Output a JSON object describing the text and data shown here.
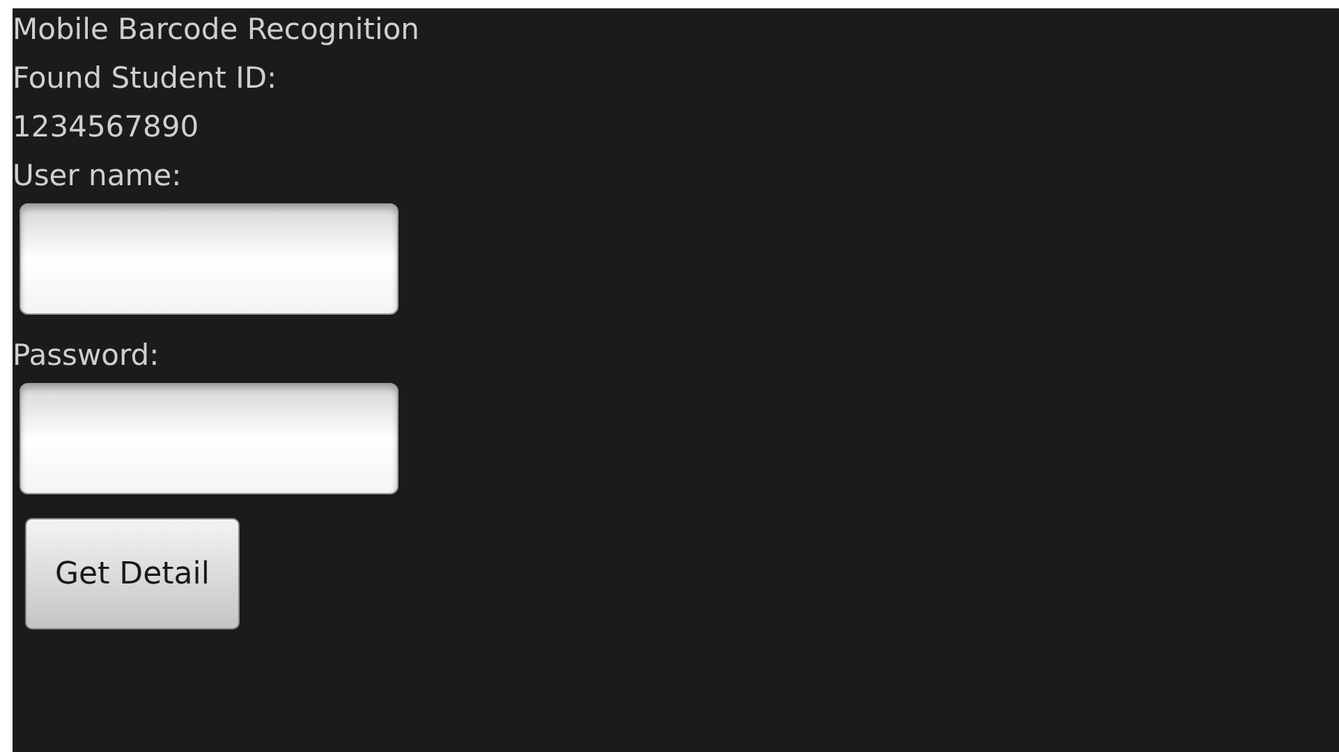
{
  "title": "Mobile Barcode Recognition",
  "found_label": "Found Student ID:",
  "student_id": "1234567890",
  "fields": [
    {
      "label": "User name:"
    },
    {
      "label": "Password:"
    }
  ],
  "button": "Get Detail"
}
